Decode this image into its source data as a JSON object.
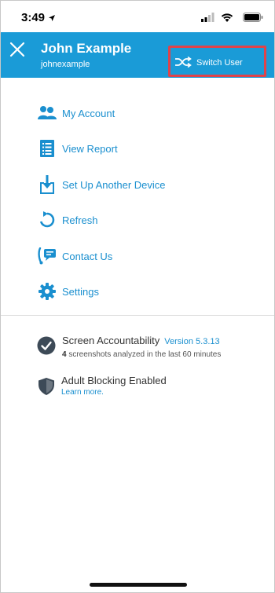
{
  "status_bar": {
    "time": "3:49"
  },
  "header": {
    "user_name": "John Example",
    "user_handle": "johnexample",
    "switch_user_label": "Switch User"
  },
  "menu": {
    "items": [
      {
        "label": "My Account",
        "icon": "users-icon"
      },
      {
        "label": "View Report",
        "icon": "report-icon"
      },
      {
        "label": "Set Up Another Device",
        "icon": "download-icon"
      },
      {
        "label": "Refresh",
        "icon": "refresh-icon"
      },
      {
        "label": "Contact Us",
        "icon": "contact-icon"
      },
      {
        "label": "Settings",
        "icon": "gear-icon"
      }
    ]
  },
  "status": {
    "screen_accountability": {
      "title": "Screen Accountability",
      "version": "Version 5.3.13",
      "count": "4",
      "detail": "screenshots analyzed in the last 60 minutes"
    },
    "adult_blocking": {
      "title": "Adult Blocking Enabled",
      "link": "Learn more."
    }
  },
  "colors": {
    "accent": "#1a9bd7",
    "link": "#1a8fcf",
    "highlight": "#e0434a"
  }
}
